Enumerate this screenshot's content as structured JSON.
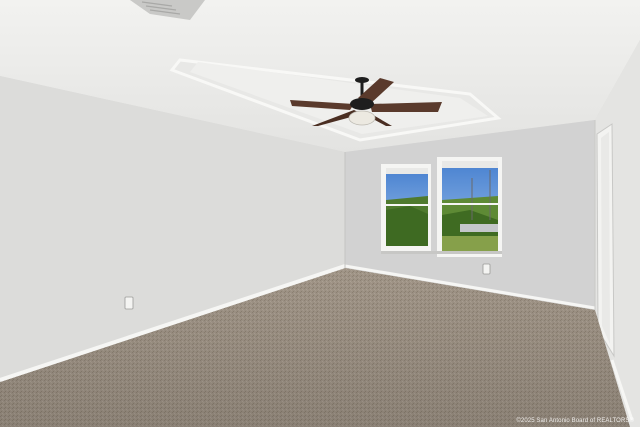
{
  "scene": {
    "subject": "empty-room",
    "colors": {
      "ceiling": "#eeeeec",
      "ceiling_shadow": "#d8d8d6",
      "wall_left": "#dcdcda",
      "wall_back": "#d2d2d2",
      "wall_right": "#e4e4e2",
      "carpet": "#a89c8e",
      "carpet_dark": "#8f8373",
      "baseboard": "#f4f4f2",
      "sky": "#5b8fd6",
      "greenery": "#4f7a2e",
      "fan_blade": "#5a3a2c",
      "fan_body": "#1e1e1e"
    }
  },
  "watermark": {
    "text": "©2025 San Antonio Board of REALTORS®"
  }
}
